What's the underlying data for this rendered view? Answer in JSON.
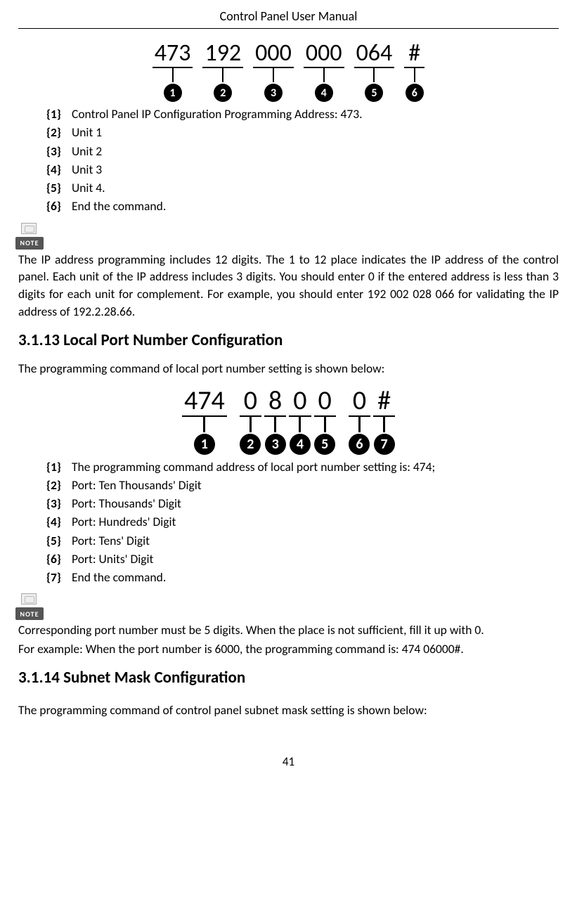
{
  "header": {
    "title": "Control Panel User Manual"
  },
  "diagram1": {
    "segments": [
      {
        "text": "473",
        "num": "1"
      },
      {
        "text": "192",
        "num": "2"
      },
      {
        "text": "000",
        "num": "3"
      },
      {
        "text": "000",
        "num": "4"
      },
      {
        "text": "064",
        "num": "5"
      },
      {
        "text": "#",
        "num": "6"
      }
    ]
  },
  "list1": {
    "items": [
      {
        "k": "{1}",
        "v": "Control Panel IP Configuration Programming Address: 473."
      },
      {
        "k": "{2}",
        "v": "Unit 1"
      },
      {
        "k": "{3}",
        "v": "Unit 2"
      },
      {
        "k": "{4}",
        "v": "Unit 3"
      },
      {
        "k": "{5}",
        "v": "Unit 4."
      },
      {
        "k": "{6}",
        "v": "End the command."
      }
    ]
  },
  "noteLabel": "NOTE",
  "para1": "The IP address programming includes 12 digits. The 1 to 12 place indicates the IP address of the control panel. Each unit of the IP address includes 3 digits. You should enter 0 if the entered address is less than 3 digits for each unit for complement. For example, you should enter 192 002 028 066 for validating the IP address of 192.2.28.66.",
  "section1": {
    "heading": "3.1.13 Local Port Number Configuration"
  },
  "para2": "The programming command of local port number setting is shown below:",
  "diagram2": {
    "segments": [
      {
        "text": "474",
        "num": "1"
      },
      {
        "text": "0",
        "num": "2"
      },
      {
        "text": "8",
        "num": "3"
      },
      {
        "text": "0",
        "num": "4"
      },
      {
        "text": "0",
        "num": "5"
      },
      {
        "text": "0",
        "num": "6"
      },
      {
        "text": "#",
        "num": "7"
      }
    ]
  },
  "list2": {
    "items": [
      {
        "k": "{1}",
        "v": "The programming command address of local port number setting is: 474;"
      },
      {
        "k": "{2}",
        "v": "Port: Ten Thousands' Digit"
      },
      {
        "k": "{3}",
        "v": "Port: Thousands' Digit"
      },
      {
        "k": "{4}",
        "v": "Port: Hundreds' Digit"
      },
      {
        "k": "{5}",
        "v": "Port: Tens' Digit"
      },
      {
        "k": "{6}",
        "v": "Port: Units' Digit"
      },
      {
        "k": "{7}",
        "v": "End the command."
      }
    ]
  },
  "para3": "Corresponding port number must be 5 digits. When the place is not sufficient, fill it up with 0.",
  "para4": "For example: When the port number is 6000, the programming command is: 474 06000#.",
  "section2": {
    "heading": "3.1.14 Subnet Mask Configuration"
  },
  "para5": "The programming command of control panel subnet mask setting is shown below:",
  "pageNum": "41"
}
